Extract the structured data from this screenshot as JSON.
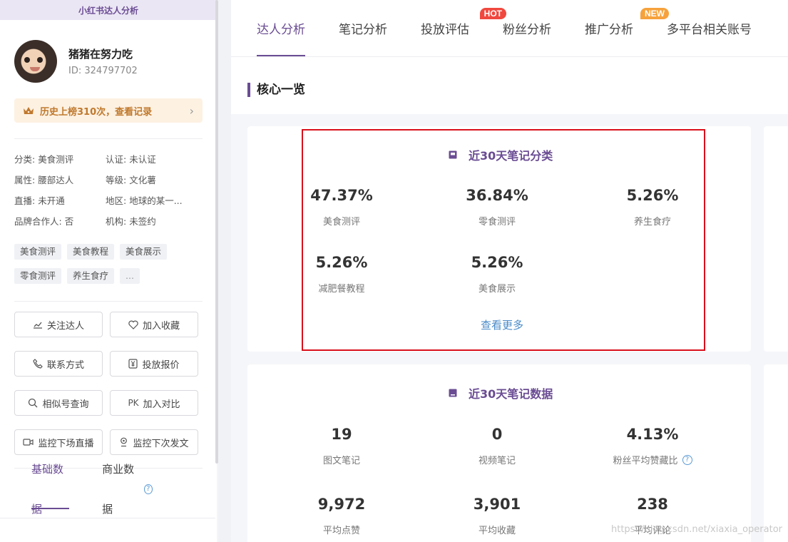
{
  "sidebar": {
    "header": "小红书达人分析",
    "profile": {
      "name": "猪猪在努力吃",
      "id_label": "ID:",
      "id": "324797702"
    },
    "rank": {
      "text": "历史上榜310次，查看记录",
      "chevron": "›"
    },
    "info": [
      {
        "label": "分类:",
        "value": "美食测评"
      },
      {
        "label": "认证:",
        "value": "未认证"
      },
      {
        "label": "属性:",
        "value": "腰部达人"
      },
      {
        "label": "等级:",
        "value": "文化薯"
      },
      {
        "label": "直播:",
        "value": "未开通"
      },
      {
        "label": "地区:",
        "value": "地球的某一..."
      },
      {
        "label": "品牌合作人:",
        "value": "否"
      },
      {
        "label": "机构:",
        "value": "未签约"
      }
    ],
    "tags": [
      "美食测评",
      "美食教程",
      "美食展示",
      "零食测评",
      "养生食疗",
      "..."
    ],
    "buttons": {
      "follow": "关注达人",
      "favorite": "加入收藏",
      "contact": "联系方式",
      "quote": "投放报价",
      "similar": "相似号查询",
      "pk_prefix": "PK",
      "pk": "加入对比",
      "monitor_live": "监控下场直播",
      "monitor_post": "监控下次发文"
    },
    "tabs": {
      "basic": "基础数据",
      "business": "商业数据"
    }
  },
  "nav": {
    "items": [
      "达人分析",
      "笔记分析",
      "投放评估",
      "粉丝分析",
      "推广分析",
      "多平台相关账号"
    ],
    "hot": "HOT",
    "new": "NEW"
  },
  "section_title": "核心一览",
  "card1": {
    "title": "近30天笔记分类",
    "stats": [
      {
        "value": "47.37%",
        "label": "美食测评"
      },
      {
        "value": "36.84%",
        "label": "零食测评"
      },
      {
        "value": "5.26%",
        "label": "养生食疗"
      },
      {
        "value": "5.26%",
        "label": "减肥餐教程"
      },
      {
        "value": "5.26%",
        "label": "美食展示"
      }
    ],
    "view_more": "查看更多"
  },
  "card2": {
    "title": "近30天笔记数据",
    "stats": [
      {
        "value": "19",
        "label": "图文笔记"
      },
      {
        "value": "0",
        "label": "视频笔记"
      },
      {
        "value": "4.13%",
        "label": "粉丝平均赞藏比"
      },
      {
        "value": "9,972",
        "label": "平均点赞"
      },
      {
        "value": "3,901",
        "label": "平均收藏"
      },
      {
        "value": "238",
        "label": "平均评论"
      }
    ]
  },
  "watermark": "https://blog.csdn.net/xiaxia_operator",
  "colors": {
    "accent": "#6a4c93",
    "hot": "#f0483e",
    "new": "#f6a23c",
    "highlight": "#d9101b",
    "link": "#4a8bc8"
  }
}
